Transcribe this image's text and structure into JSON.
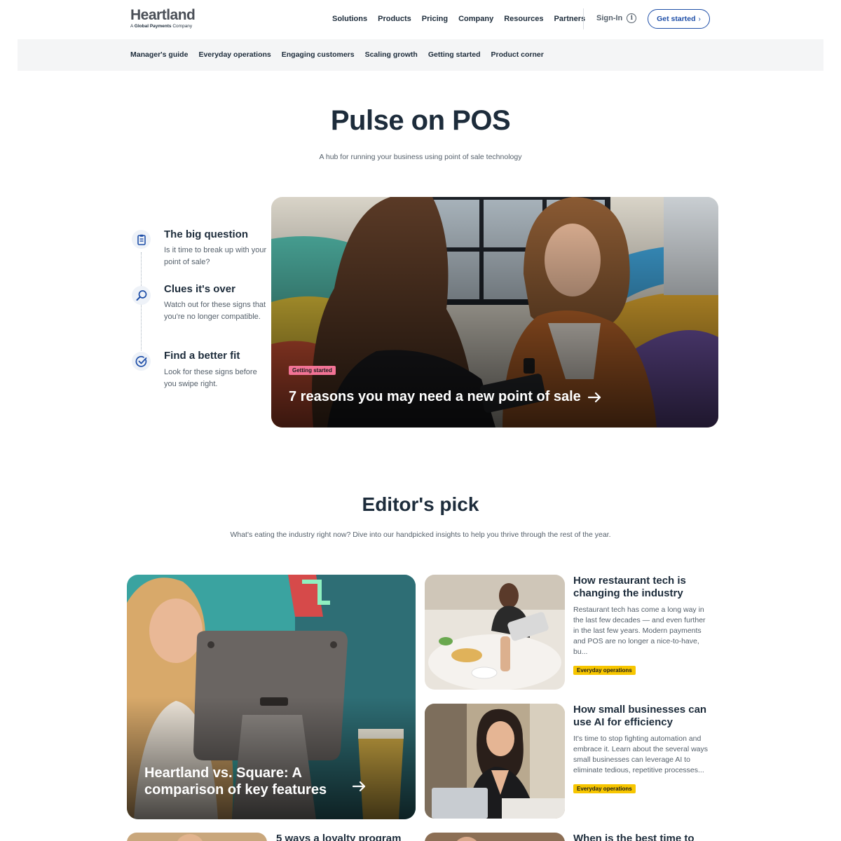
{
  "header": {
    "logo_word": "Heartland",
    "logo_sub_prefix": "A ",
    "logo_sub_bold": "Global Payments",
    "logo_sub_suffix": " Company",
    "nav": [
      "Solutions",
      "Products",
      "Pricing",
      "Company",
      "Resources",
      "Partners"
    ],
    "signin_label": "Sign-In",
    "cta_label": "Get started"
  },
  "subnav": [
    "Manager's guide",
    "Everyday operations",
    "Engaging customers",
    "Scaling growth",
    "Getting started",
    "Product corner"
  ],
  "hero": {
    "title": "Pulse on POS",
    "subtitle": "A hub for running your business using point of sale technology"
  },
  "timeline": [
    {
      "icon": "clipboard-icon",
      "title": "The big question",
      "text": "Is it time to break up with your point of sale?"
    },
    {
      "icon": "magnifier-icon",
      "title": "Clues it's over",
      "text": "Watch out for these signs that you're no longer compatible."
    },
    {
      "icon": "check-circle-icon",
      "title": "Find a better fit",
      "text": "Look for these signs before you swipe right."
    }
  ],
  "feature": {
    "tag": "Getting started",
    "title": "7 reasons you may need a new point of sale"
  },
  "editors_pick": {
    "title": "Editor's pick",
    "subtitle": "What's eating the industry right now? Dive into our handpicked insights to help you thrive through the rest of the year.",
    "big_card": {
      "title": "Heartland vs. Square: A comparison of key features"
    },
    "cards": [
      {
        "title": "How restaurant tech is changing the industry",
        "text": "Restaurant tech has come a long way in the last few decades — and even further in the last few years. Modern payments and POS are no longer a nice-to-have, bu...",
        "tag": "Everyday operations"
      },
      {
        "title": "How small businesses can use AI for efficiency",
        "text": "It's time to stop fighting automation and embrace it. Learn about the several ways small businesses can leverage AI to eliminate tedious, repetitive processes...",
        "tag": "Everyday operations"
      }
    ],
    "partial_titles": [
      "5 ways a loyalty program",
      "When is the best time to"
    ]
  },
  "colors": {
    "brand_blue": "#1f4fa8",
    "dark_text": "#1d2c3b",
    "tag_pink": "#f27396",
    "tag_yellow": "#f7c600"
  }
}
